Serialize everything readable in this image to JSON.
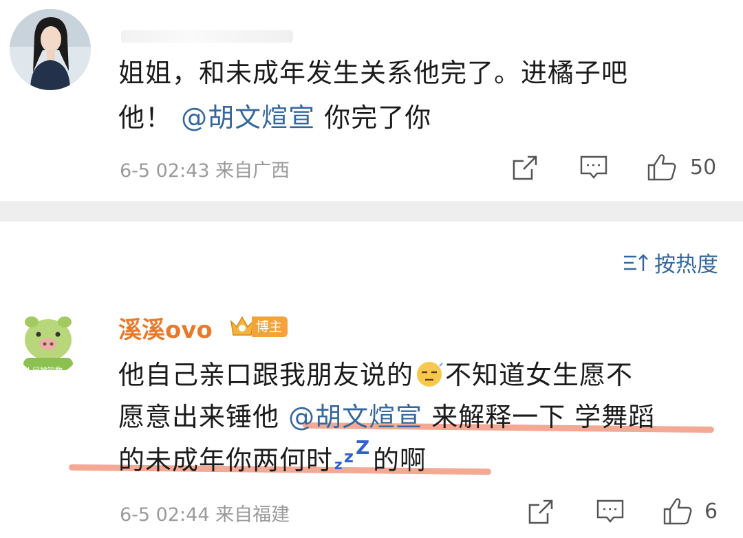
{
  "comment1": {
    "line1": "姐姐，和未成年发生关系他完了。进橘子吧",
    "line2_prefix": "他！",
    "mention": "@胡文煊宣",
    "line2_suffix": "你完了你",
    "timestamp": "6-5 02:43",
    "location": "来自广西",
    "likes": "50"
  },
  "sort": {
    "label": "按热度",
    "icon": "sort-icon"
  },
  "comment2": {
    "username": "溪溪ovo",
    "badge": "博主",
    "avatar_text": "人间被钩数",
    "line1_prefix": "他自己亲口跟我朋友说的",
    "line1_suffix": "不知道女生愿不",
    "line2_prefix": "愿意出来锤他",
    "mention": "@胡文煊宣",
    "line2_suffix": "来解释一下 学舞蹈",
    "line3_prefix": "的未成年你两何时",
    "line3_suffix": "的啊",
    "timestamp": "6-5 02:44",
    "location": "来自福建",
    "likes": "6"
  },
  "colors": {
    "mention": "#35679f",
    "username": "#e87a2c",
    "underline": "#f3a28c",
    "badge": "#f2a33a"
  }
}
